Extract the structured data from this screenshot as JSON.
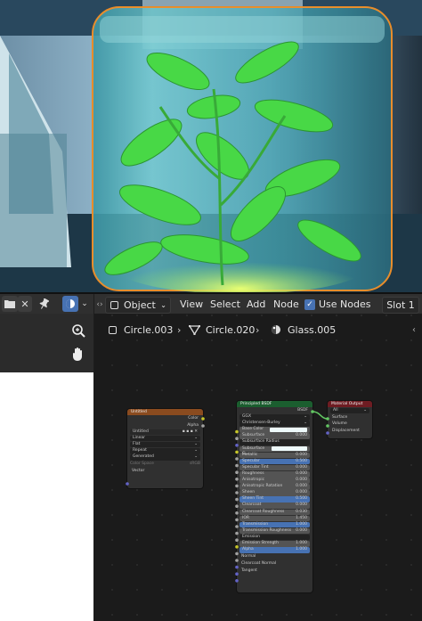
{
  "left_panel": {
    "close_glyph": "✕"
  },
  "header": {
    "editor_type": "Object",
    "menus": [
      "View",
      "Select",
      "Add",
      "Node"
    ],
    "use_nodes_label": "Use Nodes",
    "use_nodes_checked": true,
    "slot_label": "Slot 1"
  },
  "breadcrumb": {
    "object": "Circle.003",
    "mesh": "Circle.020",
    "material": "Glass.005"
  },
  "image_node": {
    "title": "Untitled",
    "outputs": [
      "Color",
      "Alpha"
    ],
    "image_name": "Untitled",
    "options": [
      "Linear",
      "Flat",
      "Repeat",
      "Generated"
    ],
    "color_space_label": "Color Space",
    "color_space_value": "sRGB",
    "input": "Vector"
  },
  "bsdf_node": {
    "title": "Principled BSDF",
    "output": "BSDF",
    "distribution": "GGX",
    "subsurface_method": "Christensen-Burley",
    "rows": [
      {
        "label": "Base Color",
        "value": "",
        "style": "color"
      },
      {
        "label": "Subsurface",
        "value": "0.000",
        "style": "field"
      },
      {
        "label": "Subsurface Radius",
        "value": "",
        "style": "select"
      },
      {
        "label": "Subsurface C...",
        "value": "",
        "style": "color"
      },
      {
        "label": "Metallic",
        "value": "0.000",
        "style": "field"
      },
      {
        "label": "Specular",
        "value": "0.500",
        "style": "blue"
      },
      {
        "label": "Specular Tint",
        "value": "0.000",
        "style": "field"
      },
      {
        "label": "Roughness",
        "value": "0.000",
        "style": "field"
      },
      {
        "label": "Anisotropic",
        "value": "0.000",
        "style": "field"
      },
      {
        "label": "Anisotropic Rotation",
        "value": "0.000",
        "style": "field"
      },
      {
        "label": "Sheen",
        "value": "0.000",
        "style": "field"
      },
      {
        "label": "Sheen Tint",
        "value": "0.500",
        "style": "blue"
      },
      {
        "label": "Clearcoat",
        "value": "0.000",
        "style": "field"
      },
      {
        "label": "Clearcoat Roughness",
        "value": "0.030",
        "style": "field"
      },
      {
        "label": "IOR",
        "value": "1.450",
        "style": "field"
      },
      {
        "label": "Transmission",
        "value": "1.000",
        "style": "blue"
      },
      {
        "label": "Transmission Roughness",
        "value": "0.000",
        "style": "field"
      },
      {
        "label": "Emission",
        "value": "",
        "style": "dark"
      },
      {
        "label": "Emission Strength",
        "value": "1.000",
        "style": "field"
      },
      {
        "label": "Alpha",
        "value": "1.000",
        "style": "blue"
      },
      {
        "label": "Normal",
        "value": "",
        "style": "socket"
      },
      {
        "label": "Clearcoat Normal",
        "value": "",
        "style": "socket"
      },
      {
        "label": "Tangent",
        "value": "",
        "style": "socket"
      }
    ]
  },
  "output_node": {
    "title": "Material Output",
    "target": "All",
    "inputs": [
      "Surface",
      "Volume",
      "Displacement"
    ]
  },
  "colors": {
    "image_header": "#8a4b1f",
    "bsdf_header": "#1b5e2f",
    "output_header": "#6e1c22",
    "accent_blue": "#4772b3",
    "selection_orange": "#e88a25",
    "socket_yellow": "#c7c729",
    "socket_grey": "#a1a1a1",
    "socket_purple": "#6363c7",
    "socket_green": "#63c763"
  }
}
